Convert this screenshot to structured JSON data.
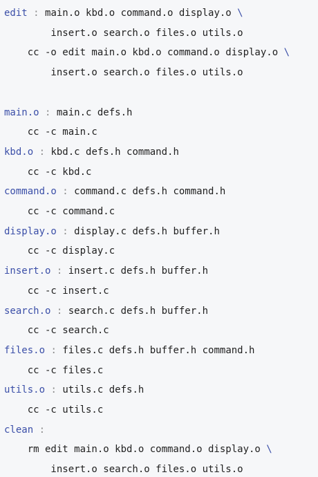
{
  "colors": {
    "background": "#f6f7f9",
    "target": "#3b4fa8",
    "colon": "#8a8a8a",
    "text": "#1f1f1f",
    "continuation": "#3b4fa8"
  },
  "makefile": {
    "lines": [
      [
        {
          "t": "edit",
          "c": "target"
        },
        {
          "t": " : ",
          "c": "colon"
        },
        {
          "t": "main.o kbd.o command.o display.o ",
          "c": "text"
        },
        {
          "t": "\\",
          "c": "cont"
        }
      ],
      [
        {
          "t": "        insert.o search.o files.o utils.o",
          "c": "text"
        }
      ],
      [
        {
          "t": "    cc -o edit main.o kbd.o command.o display.o ",
          "c": "text"
        },
        {
          "t": "\\",
          "c": "cont"
        }
      ],
      [
        {
          "t": "        insert.o search.o files.o utils.o",
          "c": "text"
        }
      ],
      [],
      [
        {
          "t": "main.o",
          "c": "target"
        },
        {
          "t": " : ",
          "c": "colon"
        },
        {
          "t": "main.c defs.h",
          "c": "text"
        }
      ],
      [
        {
          "t": "    cc -c main.c",
          "c": "text"
        }
      ],
      [
        {
          "t": "kbd.o",
          "c": "target"
        },
        {
          "t": " : ",
          "c": "colon"
        },
        {
          "t": "kbd.c defs.h command.h",
          "c": "text"
        }
      ],
      [
        {
          "t": "    cc -c kbd.c",
          "c": "text"
        }
      ],
      [
        {
          "t": "command.o",
          "c": "target"
        },
        {
          "t": " : ",
          "c": "colon"
        },
        {
          "t": "command.c defs.h command.h",
          "c": "text"
        }
      ],
      [
        {
          "t": "    cc -c command.c",
          "c": "text"
        }
      ],
      [
        {
          "t": "display.o",
          "c": "target"
        },
        {
          "t": " : ",
          "c": "colon"
        },
        {
          "t": "display.c defs.h buffer.h",
          "c": "text"
        }
      ],
      [
        {
          "t": "    cc -c display.c",
          "c": "text"
        }
      ],
      [
        {
          "t": "insert.o",
          "c": "target"
        },
        {
          "t": " : ",
          "c": "colon"
        },
        {
          "t": "insert.c defs.h buffer.h",
          "c": "text"
        }
      ],
      [
        {
          "t": "    cc -c insert.c",
          "c": "text"
        }
      ],
      [
        {
          "t": "search.o",
          "c": "target"
        },
        {
          "t": " : ",
          "c": "colon"
        },
        {
          "t": "search.c defs.h buffer.h",
          "c": "text"
        }
      ],
      [
        {
          "t": "    cc -c search.c",
          "c": "text"
        }
      ],
      [
        {
          "t": "files.o",
          "c": "target"
        },
        {
          "t": " : ",
          "c": "colon"
        },
        {
          "t": "files.c defs.h buffer.h command.h",
          "c": "text"
        }
      ],
      [
        {
          "t": "    cc -c files.c",
          "c": "text"
        }
      ],
      [
        {
          "t": "utils.o",
          "c": "target"
        },
        {
          "t": " : ",
          "c": "colon"
        },
        {
          "t": "utils.c defs.h",
          "c": "text"
        }
      ],
      [
        {
          "t": "    cc -c utils.c",
          "c": "text"
        }
      ],
      [
        {
          "t": "clean",
          "c": "target"
        },
        {
          "t": " :",
          "c": "colon"
        }
      ],
      [
        {
          "t": "    rm edit main.o kbd.o command.o display.o ",
          "c": "text"
        },
        {
          "t": "\\",
          "c": "cont"
        }
      ],
      [
        {
          "t": "        insert.o search.o files.o utils.o",
          "c": "text"
        }
      ]
    ]
  }
}
